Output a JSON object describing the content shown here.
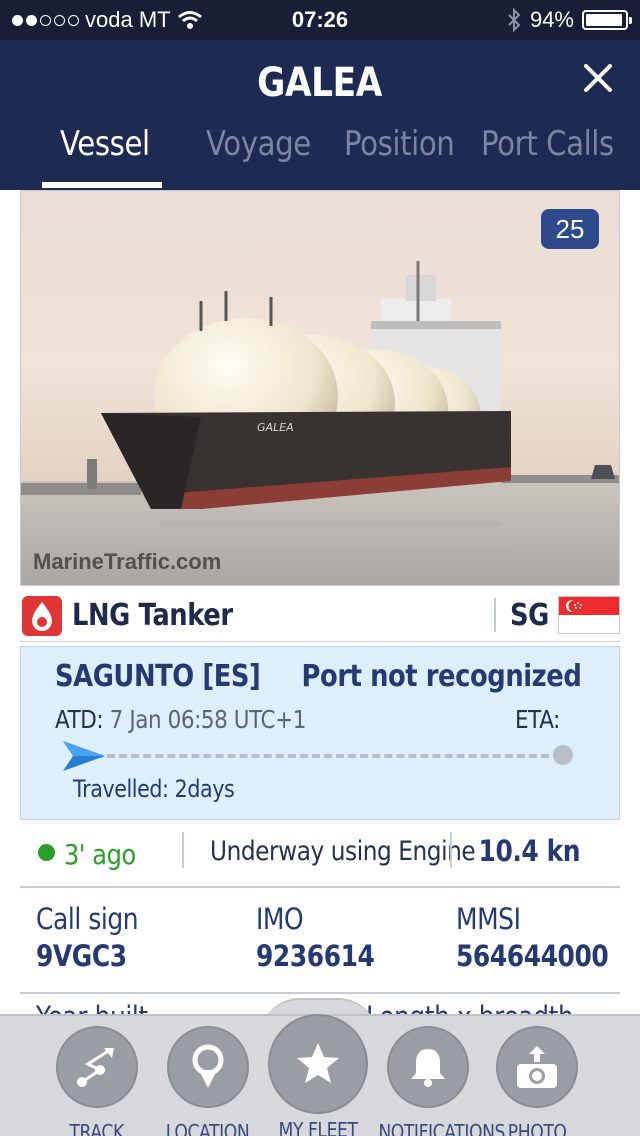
{
  "status_bar": {
    "carrier": "voda MT",
    "time": "07:26",
    "battery_percent": "94%",
    "battery_level": 0.94,
    "signal_bars": 2
  },
  "header": {
    "title": "GALEA",
    "tabs": [
      {
        "label": "Vessel",
        "active": true
      },
      {
        "label": "Voyage",
        "active": false
      },
      {
        "label": "Position",
        "active": false
      },
      {
        "label": "Port Calls",
        "active": false
      }
    ]
  },
  "photo": {
    "count": "25",
    "watermark": "MarineTraffic.com",
    "hull_name": "GALEA"
  },
  "vessel_type": {
    "label": "LNG Tanker",
    "flag_code": "SG"
  },
  "voyage": {
    "from_port": "SAGUNTO [ES]",
    "to_port": "Port not recognized",
    "atd_label": "ATD:",
    "atd_value": "7 Jan 06:58 UTC+1",
    "eta_label": "ETA:",
    "travelled": "Travelled: 2days"
  },
  "status": {
    "last_seen": "3' ago",
    "nav_status": "Underway using Engine",
    "speed": "10.4 kn"
  },
  "details": {
    "call_sign_label": "Call sign",
    "call_sign": "9VGC3",
    "imo_label": "IMO",
    "imo": "9236614",
    "mmsi_label": "MMSI",
    "mmsi": "564644000",
    "year_built_label": "Year built",
    "length_breadth_label": "Length x breadth"
  },
  "bottom_nav": [
    {
      "label": "TRACK",
      "icon": "track-icon"
    },
    {
      "label": "LOCATION",
      "icon": "location-pin-icon"
    },
    {
      "label": "MY FLEET",
      "icon": "star-icon"
    },
    {
      "label": "NOTIFICATIONS",
      "icon": "bell-icon"
    },
    {
      "label": "PHOTO",
      "icon": "camera-upload-icon"
    }
  ],
  "colors": {
    "header_bg": "#1d2b52",
    "status_bar_bg": "#171e36",
    "voyage_bg": "#dceffa",
    "accent_text": "#253a73",
    "online_green": "#2aa02a",
    "lng_icon_red": "#e03535",
    "badge_bg": "#2f4a8a"
  }
}
